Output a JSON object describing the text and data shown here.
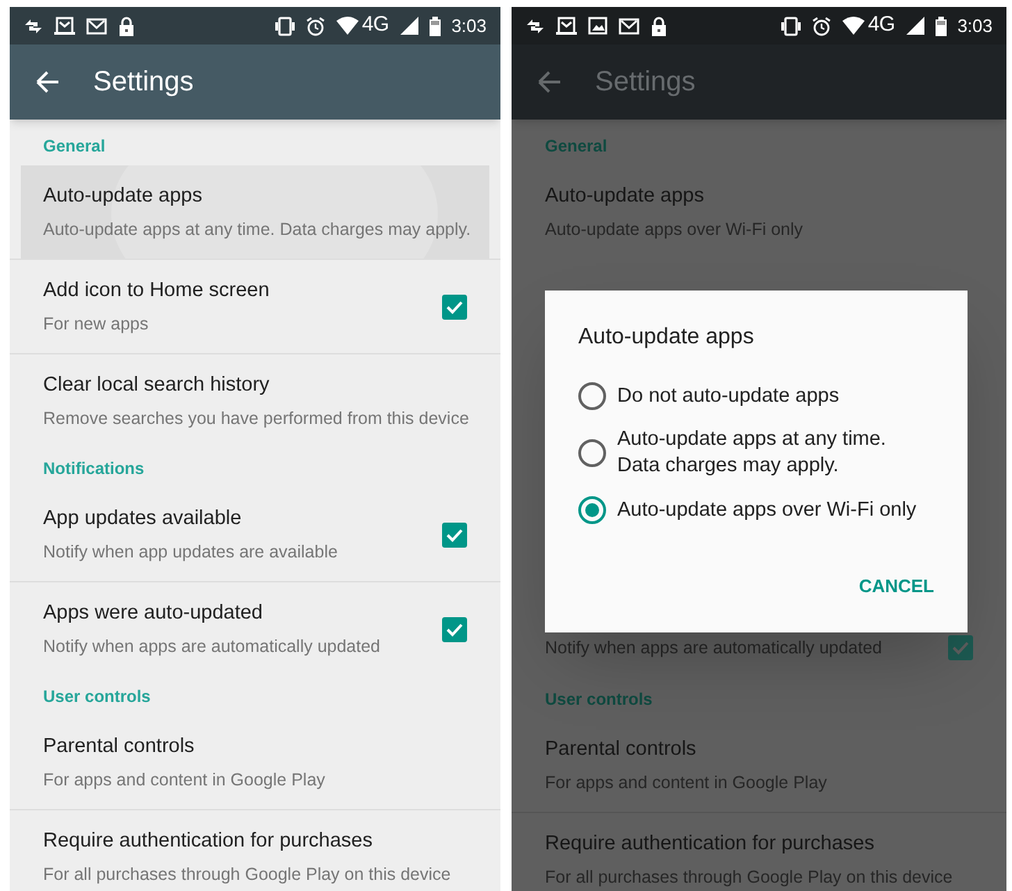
{
  "screens": [
    {
      "dimmed": false,
      "status_bar": {
        "notification_icons": [
          {
            "kind": "sync"
          },
          {
            "kind": "mail-tray"
          },
          {
            "kind": "mail"
          },
          {
            "kind": "lock"
          }
        ],
        "network": "4G",
        "time": "3:03"
      },
      "toolbar": {
        "title": "Settings"
      },
      "sections": [
        {
          "header": "General",
          "items": [
            {
              "title": "Auto-update apps",
              "subtitle": "Auto-update apps at any time. Data charges may apply.",
              "pressed": true
            },
            {
              "title": "Add icon to Home screen",
              "subtitle": "For new apps",
              "checked": true
            },
            {
              "title": "Clear local search history",
              "subtitle": "Remove searches you have performed from this device"
            }
          ]
        },
        {
          "header": "Notifications",
          "items": [
            {
              "title": "App updates available",
              "subtitle": "Notify when app updates are available",
              "checked": true
            },
            {
              "title": "Apps were auto-updated",
              "subtitle": "Notify when apps are automatically updated",
              "checked": true
            }
          ]
        },
        {
          "header": "User controls",
          "items": [
            {
              "title": "Parental controls",
              "subtitle": "For apps and content in Google Play"
            },
            {
              "title": "Require authentication for purchases",
              "subtitle": "For all purchases through Google Play on this device"
            }
          ]
        }
      ]
    },
    {
      "dimmed": true,
      "status_bar": {
        "notification_icons": [
          {
            "kind": "sync"
          },
          {
            "kind": "mail-tray"
          },
          {
            "kind": "image"
          },
          {
            "kind": "mail"
          },
          {
            "kind": "lock"
          }
        ],
        "network": "4G",
        "time": "3:03"
      },
      "toolbar": {
        "title": "Settings"
      },
      "sections": [
        {
          "header": "General",
          "items": [
            {
              "title": "Auto-update apps",
              "subtitle": "Auto-update apps over Wi-Fi only"
            }
          ]
        },
        {
          "items": [
            {
              "subtitle": "Notify when apps are automatically updated",
              "checked": true
            }
          ]
        },
        {
          "header": "User controls",
          "items": [
            {
              "title": "Parental controls",
              "subtitle": "For apps and content in Google Play"
            },
            {
              "title": "Require authentication for purchases",
              "subtitle": "For all purchases through Google Play on this device"
            }
          ]
        }
      ],
      "dialog": {
        "title": "Auto-update apps",
        "options": [
          {
            "label": "Do not auto-update apps",
            "selected": false
          },
          {
            "label": "Auto-update apps at any time. Data charges may apply.",
            "selected": false
          },
          {
            "label": "Auto-update apps over Wi-Fi only",
            "selected": true
          }
        ],
        "button": "CANCEL"
      }
    }
  ]
}
